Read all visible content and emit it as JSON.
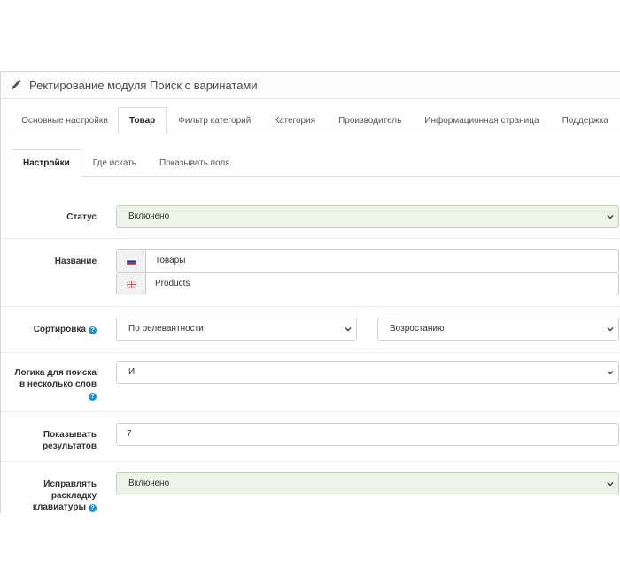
{
  "header": {
    "title": "Ректирование модуля Поиск с варинатами",
    "icon": "pencil-icon"
  },
  "main_tabs": [
    {
      "label": "Основные настройки",
      "active": false
    },
    {
      "label": "Товар",
      "active": true
    },
    {
      "label": "Фильтр категорий",
      "active": false
    },
    {
      "label": "Категория",
      "active": false
    },
    {
      "label": "Производитель",
      "active": false
    },
    {
      "label": "Информационная страница",
      "active": false
    },
    {
      "label": "Поддержка",
      "active": false
    }
  ],
  "sub_tabs": [
    {
      "label": "Настройки",
      "active": true
    },
    {
      "label": "Где искать",
      "active": false
    },
    {
      "label": "Показывать поля",
      "active": false
    }
  ],
  "form": {
    "status": {
      "label": "Статус",
      "value": "Включено"
    },
    "name": {
      "label": "Название",
      "ru_value": "Товары",
      "en_value": "Products"
    },
    "sort": {
      "label": "Сортировка",
      "field_value": "По релевантности",
      "order_value": "Возростанию"
    },
    "logic": {
      "label_line1": "Логика для поиска",
      "label_line2": "в несколько слов",
      "value": "И"
    },
    "results": {
      "label_line1": "Показывать",
      "label_line2": "результатов",
      "value": "7"
    },
    "layout": {
      "label_line1": "Исправлять",
      "label_line2": "раскладку",
      "label_line3": "клавиатуры",
      "value": "Включено"
    }
  },
  "colors": {
    "accent_help": "#1e91cf",
    "enabled_bg": "#eef3e7"
  }
}
